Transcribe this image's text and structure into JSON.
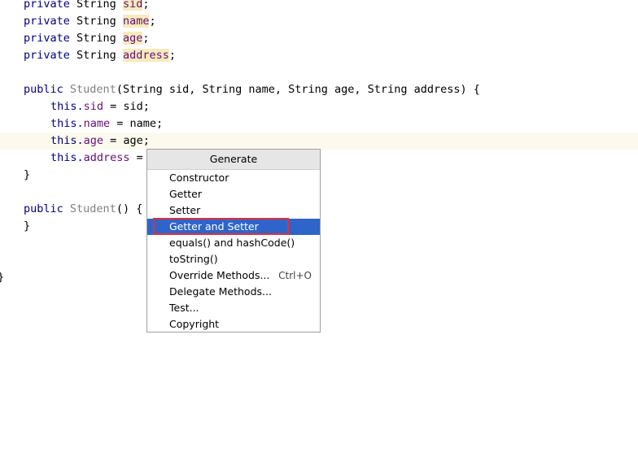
{
  "code": {
    "keyword_private": "private",
    "keyword_public": "public",
    "type_string": "String",
    "keyword_this": "this.",
    "field_sid": "sid",
    "field_name": "name",
    "field_age": "age",
    "field_address": "address",
    "semicolon": ";",
    "class_name": "Student",
    "constructor_params": "(String sid, String name, String age, String address) {",
    "assign_sid": " = sid;",
    "assign_name": " = name;",
    "assign_age": " = age;",
    "assign_address_partial": " =",
    "close_brace": "}",
    "empty_constructor_suffix": "() {"
  },
  "popup": {
    "title": "Generate",
    "items": [
      {
        "label": "Constructor",
        "shortcut": ""
      },
      {
        "label": "Getter",
        "shortcut": ""
      },
      {
        "label": "Setter",
        "shortcut": ""
      },
      {
        "label": "Getter and Setter",
        "shortcut": "",
        "selected": true
      },
      {
        "label": "equals() and hashCode()",
        "shortcut": ""
      },
      {
        "label": "toString()",
        "shortcut": ""
      },
      {
        "label": "Override Methods...",
        "shortcut": "Ctrl+O"
      },
      {
        "label": "Delegate Methods...",
        "shortcut": ""
      },
      {
        "label": "Test...",
        "shortcut": ""
      },
      {
        "label": "Copyright",
        "shortcut": ""
      }
    ]
  },
  "colors": {
    "keyword": "#000080",
    "field": "#660e7a",
    "type_name": "#808080",
    "selection": "#2f65ca",
    "annotation": "#e0303a"
  }
}
